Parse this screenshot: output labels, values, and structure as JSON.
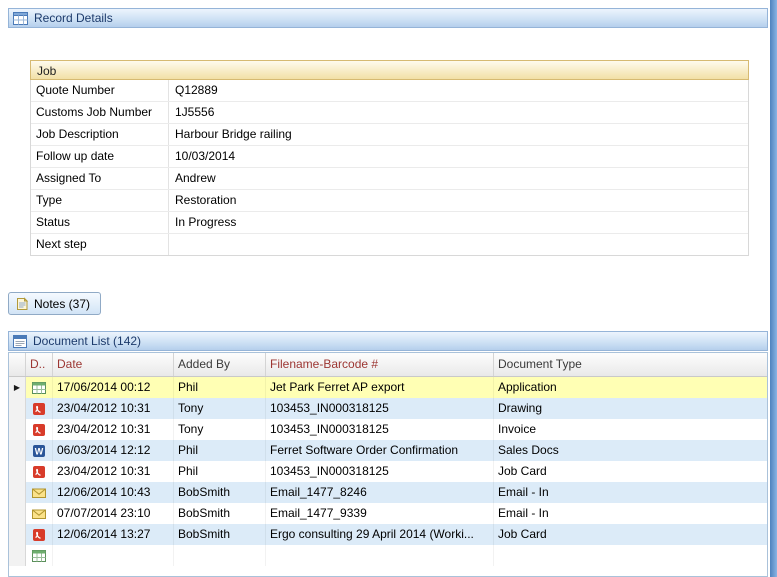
{
  "record_details": {
    "title": "Record Details"
  },
  "job": {
    "title": "Job",
    "fields": [
      {
        "label": "Quote Number",
        "value": "Q12889"
      },
      {
        "label": "Customs Job Number",
        "value": "1J5556"
      },
      {
        "label": "Job Description",
        "value": "Harbour Bridge railing"
      },
      {
        "label": "Follow up date",
        "value": "10/03/2014"
      },
      {
        "label": "Assigned To",
        "value": "Andrew"
      },
      {
        "label": "Type",
        "value": "Restoration"
      },
      {
        "label": "Status",
        "value": "In Progress"
      },
      {
        "label": "Next step",
        "value": ""
      }
    ]
  },
  "notes": {
    "label": "Notes (37)"
  },
  "document_list": {
    "title": "Document List (142)",
    "columns": [
      "D..",
      "Date",
      "Added By",
      "Filename-Barcode #",
      "Document Type"
    ],
    "rows": [
      {
        "icon": "excel-icon",
        "date": "17/06/2014 00:12",
        "added_by": "Phil",
        "filename": "Jet Park Ferret AP export",
        "type": "Application",
        "selected": true
      },
      {
        "icon": "pdf-icon",
        "date": "23/04/2012 10:31",
        "added_by": "Tony",
        "filename": "103453_IN000318125",
        "type": "Drawing"
      },
      {
        "icon": "pdf-icon",
        "date": "23/04/2012 10:31",
        "added_by": "Tony",
        "filename": "103453_IN000318125",
        "type": "Invoice"
      },
      {
        "icon": "word-icon",
        "date": "06/03/2014 12:12",
        "added_by": "Phil",
        "filename": "Ferret Software Order Confirmation",
        "type": "Sales Docs"
      },
      {
        "icon": "pdf-icon",
        "date": "23/04/2012 10:31",
        "added_by": "Phil",
        "filename": "103453_IN000318125",
        "type": "Job Card"
      },
      {
        "icon": "email-icon",
        "date": "12/06/2014 10:43",
        "added_by": "BobSmith",
        "filename": "Email_1477_8246",
        "type": "Email - In"
      },
      {
        "icon": "email-icon",
        "date": "07/07/2014 23:10",
        "added_by": "BobSmith",
        "filename": "Email_1477_9339",
        "type": "Email - In"
      },
      {
        "icon": "pdf-icon",
        "date": "12/06/2014 13:27",
        "added_by": "BobSmith",
        "filename": "Ergo consulting 29 April 2014 (Worki...",
        "type": "Job Card"
      },
      {
        "icon": "excel-icon",
        "date": "",
        "added_by": "",
        "filename": "",
        "type": ""
      }
    ]
  },
  "colors": {
    "panel_header_text": "#1c3a6b",
    "sorted_column_text": "#9c3632",
    "selected_row_bg": "#ffffb4",
    "alt_row_bg": "#dcebf8",
    "job_header_bg": "#f2e0a6"
  }
}
